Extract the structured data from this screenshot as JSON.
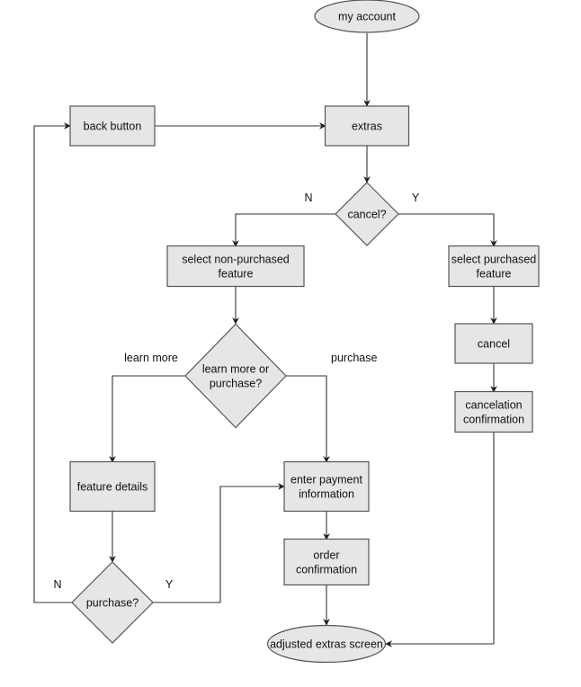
{
  "colors": {
    "fill": "#e6e6e6",
    "stroke": "#555555",
    "line": "#333333"
  },
  "nodes": [
    {
      "id": "my-account",
      "shape": "ellipse",
      "lines": [
        "my account"
      ]
    },
    {
      "id": "back-button",
      "shape": "rect",
      "lines": [
        "back button"
      ]
    },
    {
      "id": "extras",
      "shape": "rect",
      "lines": [
        "extras"
      ]
    },
    {
      "id": "cancel-decision",
      "shape": "diamond",
      "lines": [
        "cancel?"
      ]
    },
    {
      "id": "select-non-purchased",
      "shape": "rect",
      "lines": [
        "select non-purchased",
        "feature"
      ]
    },
    {
      "id": "select-purchased",
      "shape": "rect",
      "lines": [
        "select purchased",
        "feature"
      ]
    },
    {
      "id": "learn-or-purchase",
      "shape": "diamond",
      "lines": [
        "learn more or",
        "purchase?"
      ]
    },
    {
      "id": "cancel",
      "shape": "rect",
      "lines": [
        "cancel"
      ]
    },
    {
      "id": "cancelation-confirmation",
      "shape": "rect",
      "lines": [
        "cancelation",
        "confirmation"
      ]
    },
    {
      "id": "feature-details",
      "shape": "rect",
      "lines": [
        "feature details"
      ]
    },
    {
      "id": "enter-payment",
      "shape": "rect",
      "lines": [
        "enter payment",
        "information"
      ]
    },
    {
      "id": "order-confirmation",
      "shape": "rect",
      "lines": [
        "order",
        "confirmation"
      ]
    },
    {
      "id": "purchase-decision",
      "shape": "diamond",
      "lines": [
        "purchase?"
      ]
    },
    {
      "id": "adjusted-extras",
      "shape": "ellipse",
      "lines": [
        "adjusted extras screen"
      ]
    }
  ],
  "edges": [
    {
      "from": "my-account",
      "to": "extras",
      "label": ""
    },
    {
      "from": "back-button",
      "to": "extras",
      "label": ""
    },
    {
      "from": "extras",
      "to": "cancel-decision",
      "label": ""
    },
    {
      "from": "cancel-decision",
      "to": "select-non-purchased",
      "label": "N"
    },
    {
      "from": "cancel-decision",
      "to": "select-purchased",
      "label": "Y"
    },
    {
      "from": "select-non-purchased",
      "to": "learn-or-purchase",
      "label": ""
    },
    {
      "from": "learn-or-purchase",
      "to": "feature-details",
      "label": "learn more"
    },
    {
      "from": "learn-or-purchase",
      "to": "enter-payment",
      "label": "purchase"
    },
    {
      "from": "select-purchased",
      "to": "cancel",
      "label": ""
    },
    {
      "from": "cancel",
      "to": "cancelation-confirmation",
      "label": ""
    },
    {
      "from": "cancelation-confirmation",
      "to": "adjusted-extras",
      "label": ""
    },
    {
      "from": "feature-details",
      "to": "purchase-decision",
      "label": ""
    },
    {
      "from": "purchase-decision",
      "to": "back-button",
      "label": "N"
    },
    {
      "from": "purchase-decision",
      "to": "enter-payment",
      "label": "Y"
    },
    {
      "from": "enter-payment",
      "to": "order-confirmation",
      "label": ""
    },
    {
      "from": "order-confirmation",
      "to": "adjusted-extras",
      "label": ""
    }
  ]
}
